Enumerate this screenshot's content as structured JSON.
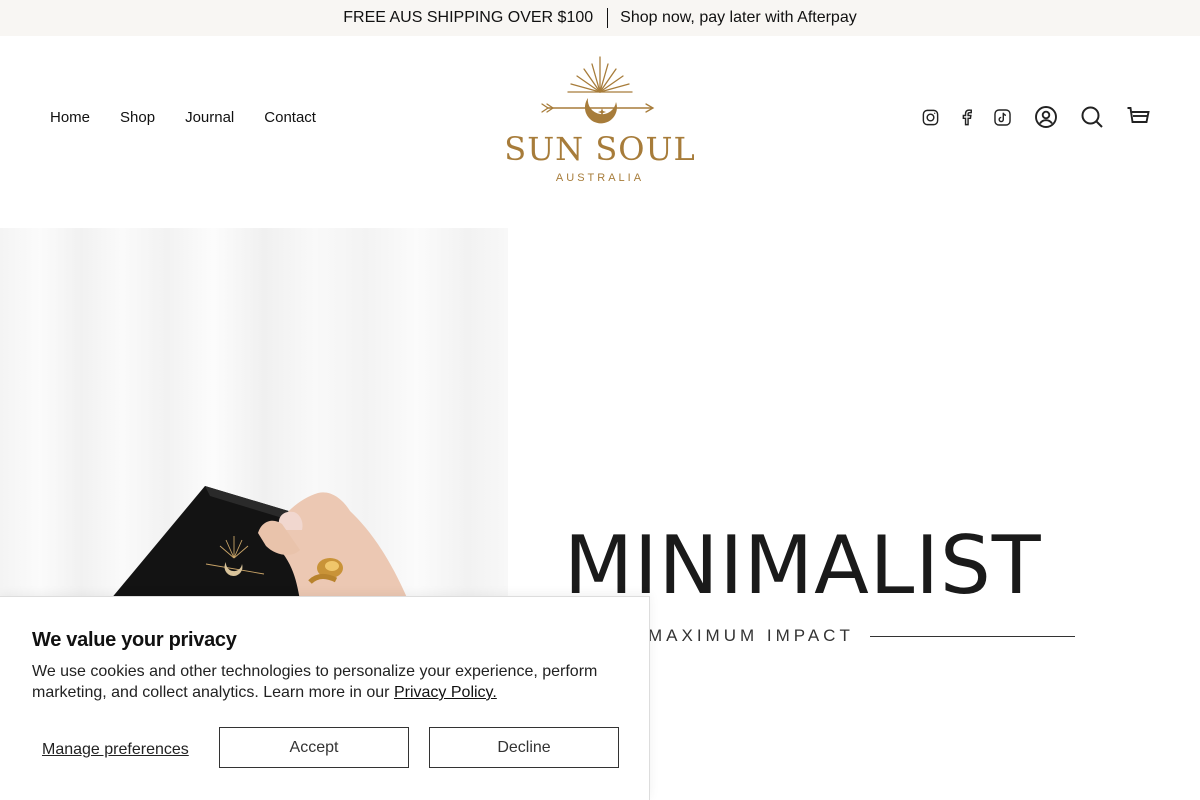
{
  "announcement": {
    "shipping": "FREE AUS SHIPPING OVER $100",
    "afterpay": "Shop now, pay later with Afterpay"
  },
  "nav": {
    "items": [
      {
        "label": "Home"
      },
      {
        "label": "Shop"
      },
      {
        "label": "Journal"
      },
      {
        "label": "Contact"
      }
    ]
  },
  "logo": {
    "name": "SUN SOUL",
    "tagline": "AUSTRALIA",
    "color": "#a77c3a"
  },
  "header_icons": [
    "instagram-icon",
    "facebook-icon",
    "tiktok-icon",
    "account-icon",
    "search-icon",
    "cart-icon"
  ],
  "hero": {
    "title": "MINIMALIST",
    "subtitle": "MAXIMUM IMPACT"
  },
  "cookie": {
    "title": "We value your privacy",
    "body": "We use cookies and other technologies to personalize your experience, perform marketing, and collect analytics. Learn more in our",
    "link": "Privacy Policy.",
    "manage": "Manage preferences",
    "accept": "Accept",
    "decline": "Decline"
  }
}
